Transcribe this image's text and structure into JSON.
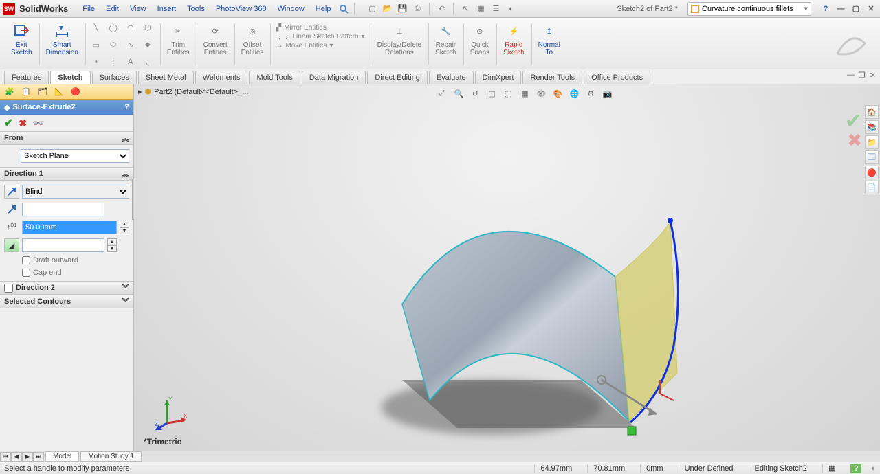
{
  "app": {
    "name": "SolidWorks"
  },
  "menu": [
    "File",
    "Edit",
    "View",
    "Insert",
    "Tools",
    "PhotoView 360",
    "Window",
    "Help"
  ],
  "doc_name": "Sketch2 of Part2 *",
  "search_placeholder": "Curvature continuous fillets",
  "ribbon": {
    "exit_sketch": "Exit\nSketch",
    "smart_dim": "Smart\nDimension",
    "trim": "Trim\nEntities",
    "convert": "Convert\nEntities",
    "offset": "Offset\nEntities",
    "mirror": "Mirror Entities",
    "linear": "Linear Sketch Pattern",
    "move": "Move Entities",
    "display_delete": "Display/Delete\nRelations",
    "repair": "Repair\nSketch",
    "quick_snaps": "Quick\nSnaps",
    "rapid": "Rapid\nSketch",
    "normal_to": "Normal\nTo"
  },
  "cmd_tabs": [
    "Features",
    "Sketch",
    "Surfaces",
    "Sheet Metal",
    "Weldments",
    "Mold Tools",
    "Data Migration",
    "Direct Editing",
    "Evaluate",
    "DimXpert",
    "Render Tools",
    "Office Products"
  ],
  "cmd_active": 1,
  "breadcrumb": "Part2  (Default<<Default>_...",
  "pm": {
    "feature_name": "Surface-Extrude2",
    "sections": {
      "from": {
        "title": "From",
        "value": "Sketch Plane"
      },
      "dir1": {
        "title": "Direction 1",
        "end": "Blind",
        "depth": "50.00mm",
        "draft_outward": "Draft outward",
        "cap_end": "Cap end"
      },
      "dir2": {
        "title": "Direction 2"
      },
      "selcon": {
        "title": "Selected Contours"
      }
    }
  },
  "view_name": "*Trimetric",
  "bottom_tabs": [
    "Model",
    "Motion Study 1"
  ],
  "status": {
    "msg": "Select a handle to modify parameters",
    "x": "64.97mm",
    "y": "70.81mm",
    "z": "0mm",
    "def": "Under Defined",
    "edit": "Editing Sketch2"
  }
}
